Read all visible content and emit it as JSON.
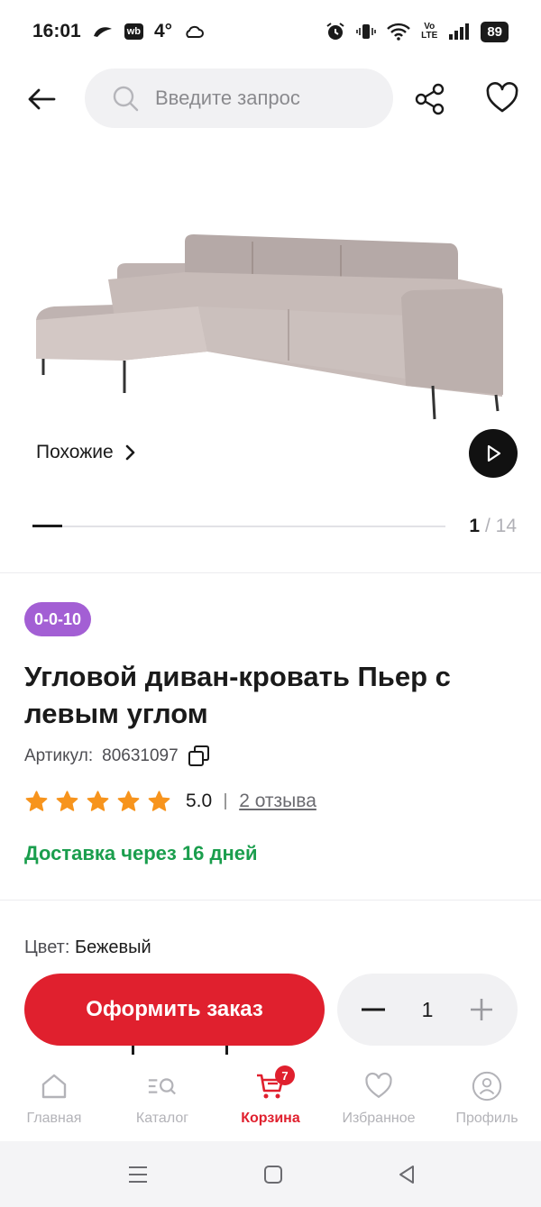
{
  "status": {
    "time": "16:01",
    "wb": "wb",
    "temp": "4°",
    "lte_top": "Vo",
    "lte_bottom": "LTE",
    "battery": "89"
  },
  "search": {
    "placeholder": "Введите запрос"
  },
  "gallery": {
    "similar_label": "Похожие",
    "current": "1",
    "separator": "/",
    "total": "14",
    "progress": 0.0714
  },
  "product": {
    "tag": "0-0-10",
    "title": "Угловой диван-кровать Пьер с левым углом",
    "article_label": "Артикул:",
    "article_value": "80631097",
    "rating": "5.0",
    "reviews": "2 отзыва",
    "delivery": "Доставка через 16 дней",
    "color_label": "Цвет:",
    "color_value": "Бежевый"
  },
  "actions": {
    "order_label": "Оформить заказ",
    "quantity": "1"
  },
  "tabbar": {
    "home": "Главная",
    "catalog": "Каталог",
    "cart": "Корзина",
    "cart_badge": "7",
    "favorites": "Избранное",
    "profile": "Профиль"
  },
  "colors": {
    "accent": "#e0202e",
    "tag": "#a35fd4",
    "delivery": "#1a9e4d",
    "star": "#f7941d"
  }
}
